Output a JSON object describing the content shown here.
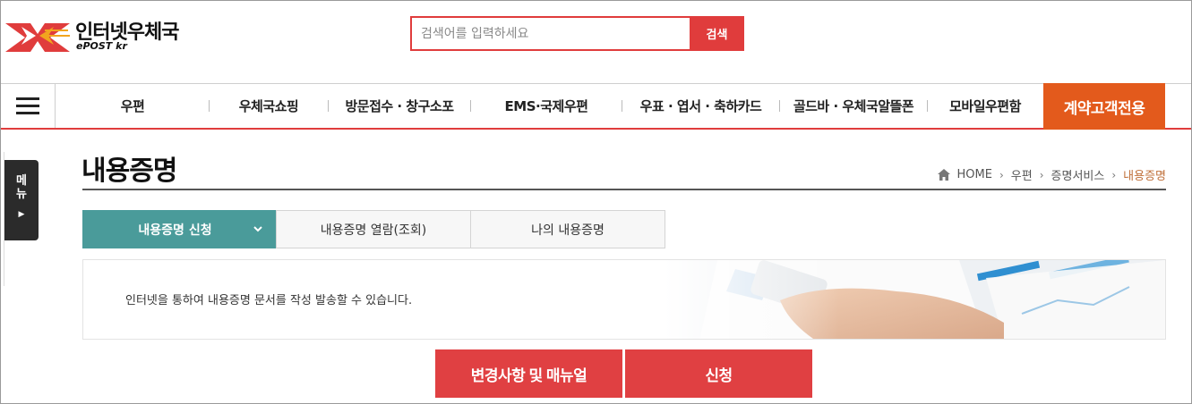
{
  "header": {
    "logo_title": "인터넷우체국",
    "logo_sub": "ePOST kr",
    "search_placeholder": "검색어를 입력하세요",
    "search_button": "검색"
  },
  "nav": {
    "items": [
      "우편",
      "우체국쇼핑",
      "방문접수 · 창구소포",
      "EMS·국제우편",
      "우표 · 엽서 · 축하카드",
      "골드바 · 우체국알뜰폰",
      "모바일우편함"
    ],
    "special": "계약고객전용"
  },
  "side_menu": {
    "label": "메뉴"
  },
  "page": {
    "title": "내용증명",
    "breadcrumb": [
      "HOME",
      "우편",
      "증명서비스",
      "내용증명"
    ]
  },
  "tabs": [
    "내용증명 신청",
    "내용증명 열람(조회)",
    "나의 내용증명"
  ],
  "banner": {
    "text": "인터넷을 통하여 내용증명 문서를 작성 발송할 수 있습니다."
  },
  "buttons": {
    "manual": "변경사항 및 매뉴얼",
    "apply": "신청"
  },
  "colors": {
    "accent_red": "#e03c3c",
    "teal": "#4a9b9a",
    "orange": "#e35a1c"
  }
}
